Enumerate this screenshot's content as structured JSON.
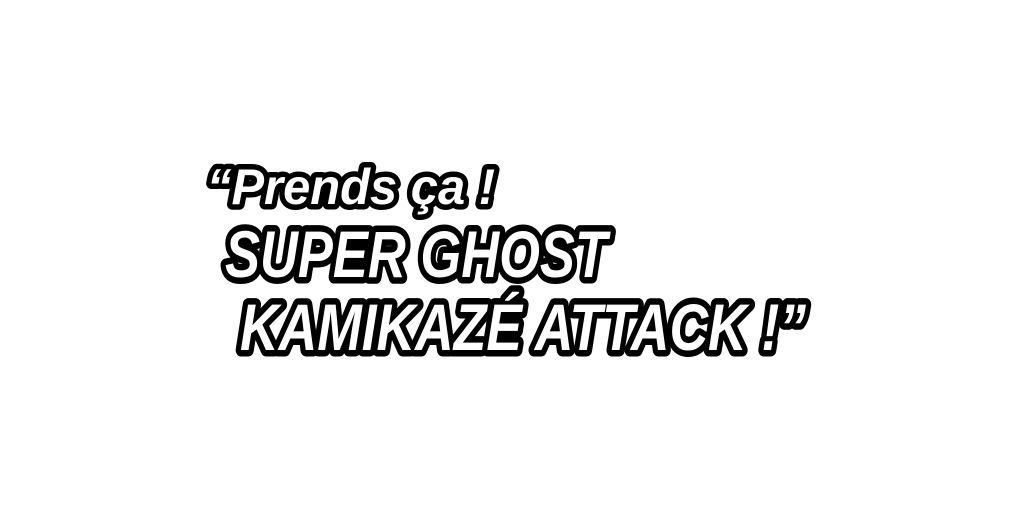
{
  "quote": {
    "line1": "“Prends ça !",
    "line2": "SUPER GHOST",
    "line3": "KAMIKAZÉ ATTACK !”"
  },
  "colors": {
    "background": "#ffffff",
    "text_fill": "#ffffff",
    "text_outline": "#000000"
  }
}
